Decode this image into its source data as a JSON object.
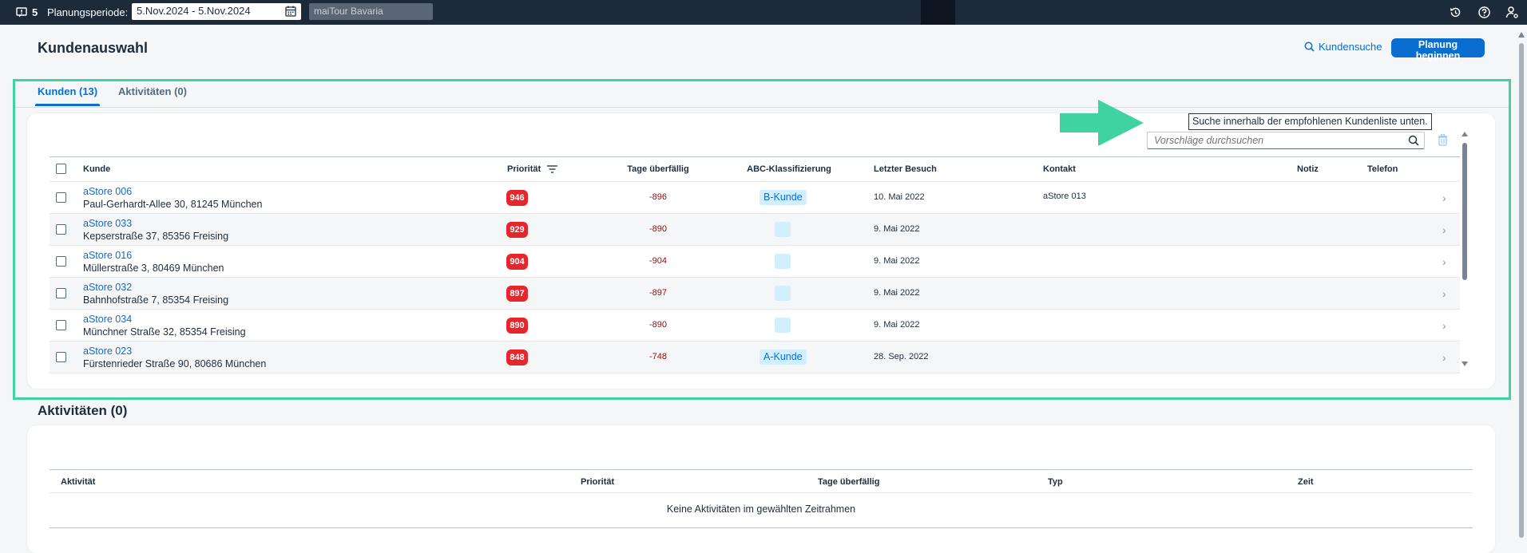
{
  "shell": {
    "notification_count": "5",
    "period_label": "Planungsperiode:",
    "date_range": "5.Nov.2024 - 5.Nov.2024",
    "tour": "maiTour Bavaria"
  },
  "header": {
    "title": "Kundenauswahl",
    "search_link": "Kundensuche",
    "primary_button": "Planung beginnen"
  },
  "tabs": [
    {
      "label": "Kunden (13)",
      "active": true
    },
    {
      "label": "Aktivitäten (0)",
      "active": false
    }
  ],
  "customers": {
    "tooltip": "Suche innerhalb der empfohlenen Kundenliste unten.",
    "search_placeholder": "Vorschläge durchsuchen",
    "columns": [
      "Kunde",
      "Priorität",
      "Tage überfällig",
      "ABC-Klassifizierung",
      "Letzter Besuch",
      "Kontakt",
      "Notiz",
      "Telefon"
    ],
    "rows": [
      {
        "name": "aStore 006",
        "address": "Paul-Gerhardt-Allee 30, 81245 München",
        "priority": "946",
        "overdue": "-896",
        "abc": "B-Kunde",
        "last_visit": "10. Mai 2022",
        "contact": "aStore 013"
      },
      {
        "name": "aStore 033",
        "address": "Kepserstraße 37, 85356 Freising",
        "priority": "929",
        "overdue": "-890",
        "abc": "",
        "last_visit": "9. Mai 2022",
        "contact": ""
      },
      {
        "name": "aStore 016",
        "address": "Müllerstraße 3, 80469 München",
        "priority": "904",
        "overdue": "-904",
        "abc": "",
        "last_visit": "9. Mai 2022",
        "contact": ""
      },
      {
        "name": "aStore 032",
        "address": "Bahnhofstraße 7, 85354 Freising",
        "priority": "897",
        "overdue": "-897",
        "abc": "",
        "last_visit": "9. Mai 2022",
        "contact": ""
      },
      {
        "name": "aStore 034",
        "address": "Münchner Straße 32, 85354 Freising",
        "priority": "890",
        "overdue": "-890",
        "abc": "",
        "last_visit": "9. Mai 2022",
        "contact": ""
      },
      {
        "name": "aStore 023",
        "address": "Fürstenrieder Straße 90, 80686 München",
        "priority": "848",
        "overdue": "-748",
        "abc": "A-Kunde",
        "last_visit": "28. Sep. 2022",
        "contact": ""
      }
    ]
  },
  "activities": {
    "title": "Aktivitäten (0)",
    "columns": [
      "Aktivität",
      "Priorität",
      "Tage überfällig",
      "Typ",
      "Zeit"
    ],
    "empty_text": "Keine Aktivitäten im gewählten Zeitrahmen"
  },
  "colors": {
    "accent": "#0a6ed1",
    "priority_badge": "#e4262d",
    "highlight": "#3fd3a2",
    "shell": "#1d2a3a"
  }
}
